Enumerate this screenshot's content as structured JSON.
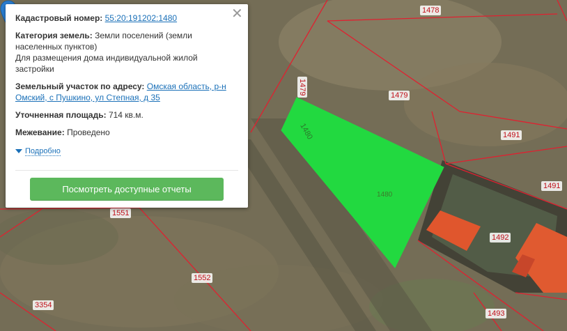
{
  "map": {
    "parcel_labels": [
      "1478",
      "1479",
      "1479",
      "1480",
      "1480",
      "1491",
      "1491",
      "1492",
      "1493",
      "1551",
      "1552",
      "3354",
      "1480"
    ]
  },
  "card": {
    "cadastral_label": "Кадастровый номер:",
    "cadastral_value": "55:20:191202:1480",
    "category_label": "Категория земель:",
    "category_value": "Земли поселений (земли населенных пунктов)",
    "category_use": "Для размещения дома индивидуальной жилой застройки",
    "address_label": "Земельный участок по адресу:",
    "address_value": "Омская область, р-н Омский, с Пушкино, ул Степная, д 35",
    "area_label": "Уточненная площадь:",
    "area_value": "714 кв.м.",
    "survey_label": "Межевание:",
    "survey_value": "Проведено",
    "more_label": "Подробно",
    "reports_button": "Посмотреть доступные отчеты",
    "close_symbol": "✕"
  },
  "colors": {
    "highlight_parcel": "#22d940",
    "parcel_border": "#e02030",
    "button": "#5cb85c",
    "link": "#1a70b8",
    "pin": "#2a7fd4"
  },
  "icons": [
    "close-icon",
    "location-pin-icon",
    "expand-triangle-icon"
  ]
}
